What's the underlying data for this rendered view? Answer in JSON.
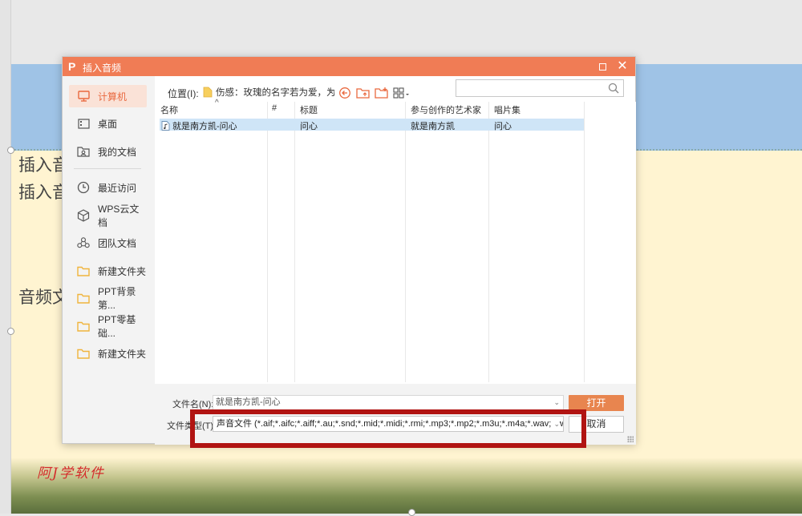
{
  "background_slide": {
    "text_lines": [
      "插入音",
      "插入音",
      "音频文"
    ],
    "watermark": "阿J学软件"
  },
  "dialog": {
    "title": "插入音频",
    "location_label": "位置(I):",
    "location_value": "伤感：玫瑰的名字若为爱，为何沉",
    "search_placeholder": "",
    "sidebar": [
      {
        "label": "计算机",
        "icon": "computer-icon",
        "active": true
      },
      {
        "label": "桌面",
        "icon": "desktop-icon"
      },
      {
        "label": "我的文档",
        "icon": "documents-icon"
      },
      {
        "label": "最近访问",
        "icon": "clock-icon"
      },
      {
        "label": "WPS云文档",
        "icon": "cube-icon"
      },
      {
        "label": "团队文档",
        "icon": "team-icon"
      },
      {
        "label": "新建文件夹",
        "icon": "folder-icon"
      },
      {
        "label": "PPT背景第...",
        "icon": "folder-icon"
      },
      {
        "label": "PPT零基础...",
        "icon": "folder-icon"
      },
      {
        "label": "新建文件夹",
        "icon": "folder-icon"
      }
    ],
    "columns": [
      "名称",
      "#",
      "标题",
      "参与创作的艺术家",
      "唱片集"
    ],
    "files": [
      {
        "name": "就是南方凯-问心",
        "number": "",
        "title": "问心",
        "artist": "就是南方凯",
        "album": "问心"
      }
    ],
    "filename_label": "文件名(N):",
    "filename_value": "就是南方凯-问心",
    "filetype_label": "文件类型(T):",
    "filetype_value": "声音文件 (*.aif;*.aifc;*.aiff;*.au;*.snd;*.mid;*.midi;*.rmi;*.mp3;*.mp2;*.m3u;*.m4a;*.wav;*.wma;*.wax)",
    "open_button": "打开",
    "cancel_button": "取消"
  },
  "colors": {
    "titlebar": "#f07c55",
    "accent": "#e9693f",
    "highlight_frame": "#b11412",
    "selection": "#cfe5f7"
  }
}
